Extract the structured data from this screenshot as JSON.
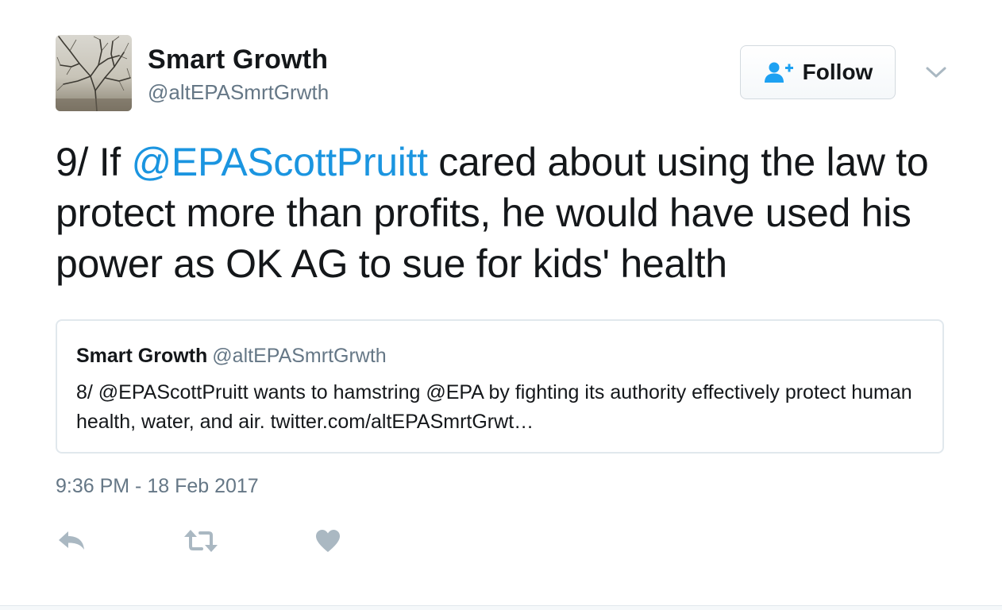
{
  "tweet": {
    "author": {
      "display_name": "Smart Growth",
      "screen_name": "@altEPASmrtGrwth"
    },
    "follow_label": "Follow",
    "text": {
      "prefix": "9/ If ",
      "mention": "@EPAScottPruitt",
      "suffix": " cared about using the law to protect more than profits, he would have used his power as OK AG to sue for kids' health"
    },
    "quoted": {
      "display_name": "Smart Growth",
      "screen_name": "@altEPASmrtGrwth",
      "text": "8/ @EPAScottPruitt wants to hamstring @EPA by fighting its authority effectively protect human health, water, and air. twitter.com/altEPASmrtGrwt…"
    },
    "timestamp": "9:36 PM - 18 Feb 2017",
    "actions": [
      "reply-icon",
      "retweet-icon",
      "like-icon"
    ]
  },
  "colors": {
    "link": "#1b95e0",
    "secondary_text": "#657786",
    "primary_text": "#14171a",
    "follow_icon": "#1da1f2",
    "action_icon": "#aab8c2",
    "border": "#e1e8ed"
  }
}
